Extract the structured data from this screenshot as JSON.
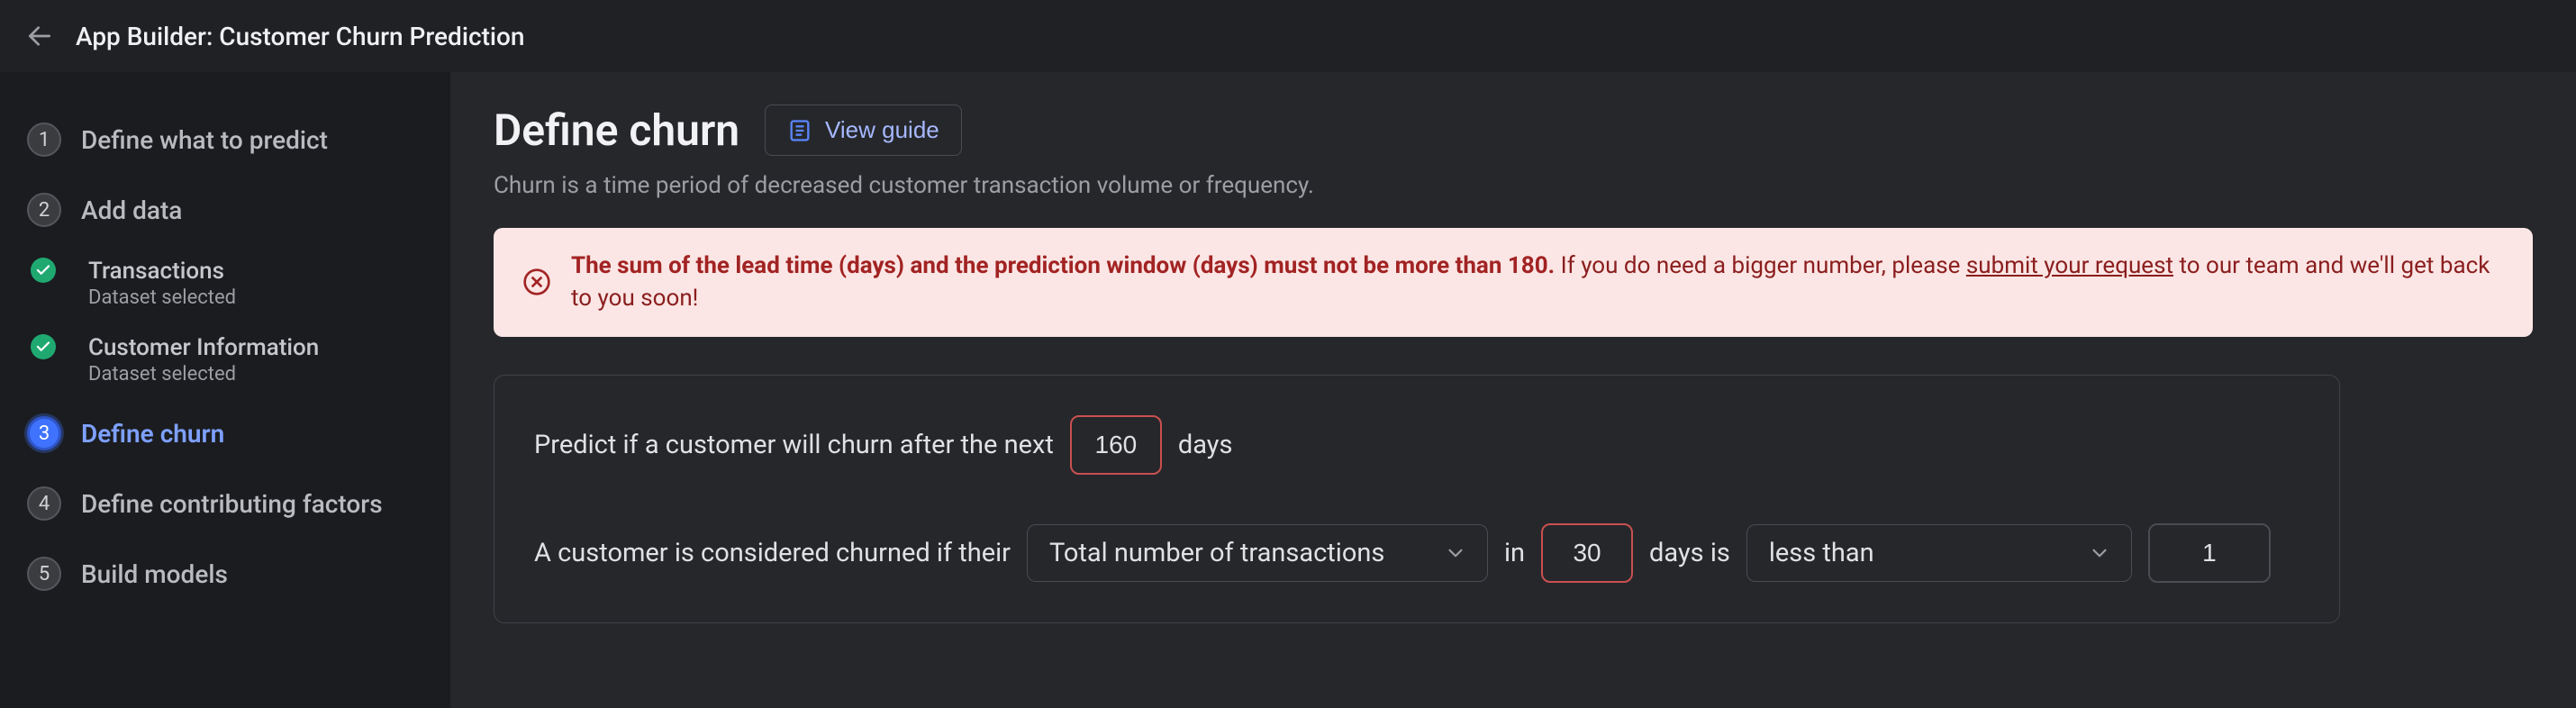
{
  "header": {
    "title": "App Builder: Customer Churn Prediction"
  },
  "sidebar": {
    "steps": [
      {
        "num": "1",
        "label": "Define what to predict"
      },
      {
        "num": "2",
        "label": "Add data"
      }
    ],
    "datasets": [
      {
        "label": "Transactions",
        "sub": "Dataset selected"
      },
      {
        "label": "Customer Information",
        "sub": "Dataset selected"
      }
    ],
    "current": {
      "num": "3",
      "label": "Define churn"
    },
    "after": [
      {
        "num": "4",
        "label": "Define contributing factors"
      },
      {
        "num": "5",
        "label": "Build models"
      }
    ]
  },
  "page": {
    "title": "Define churn",
    "view_guide": "View guide",
    "subtitle": "Churn is a time period of decreased customer transaction volume or frequency."
  },
  "alert": {
    "bold": "The sum of the lead time (days) and the prediction window (days) must not be more than 180.",
    "normal_pre": " If you do need a bigger number, please ",
    "link": "submit your request",
    "normal_post": " to our team and we'll get back to you soon!"
  },
  "form": {
    "row1_pre": "Predict if a customer will churn after the next",
    "lead_time": "160",
    "row1_post": "days",
    "row2_pre": "A customer is considered churned if their",
    "metric": "Total number of transactions",
    "row2_in": "in",
    "window": "30",
    "row2_daysis": "days is",
    "comparator": "less than",
    "threshold": "1"
  }
}
